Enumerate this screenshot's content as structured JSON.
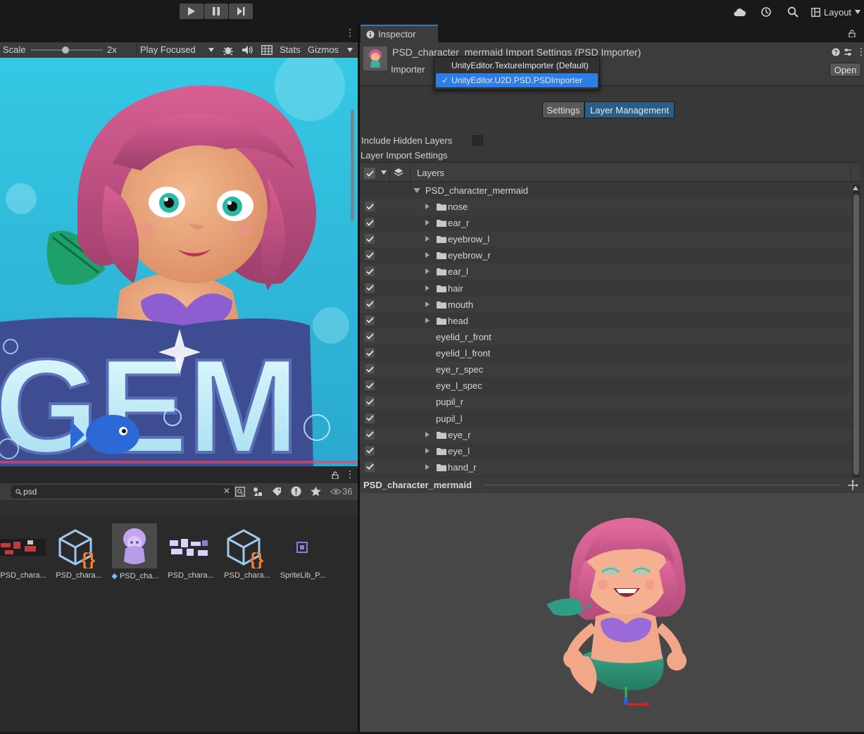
{
  "toolbar": {
    "play_icon": "play-icon",
    "pause_icon": "pause-icon",
    "step_icon": "step-icon",
    "layout_label": "Layout"
  },
  "game": {
    "scale_label": "Scale",
    "scale_value": "2x",
    "play_mode": "Play Focused",
    "stats_label": "Stats",
    "gizmos_label": "Gizmos",
    "title_text": "GEM"
  },
  "project": {
    "search_value": "psd",
    "count": "36",
    "assets": [
      {
        "label": "PSD_chara...",
        "icon": "layer-sprite-sheet-icon"
      },
      {
        "label": "PSD_chara...",
        "icon": "cube-script-icon"
      },
      {
        "label": "PSD_cha...",
        "icon": "mermaid-prefab-icon"
      },
      {
        "label": "PSD_chara...",
        "icon": "layer-sprite-sheet-icon"
      },
      {
        "label": "PSD_chara...",
        "icon": "cube-script-icon"
      },
      {
        "label": "SpriteLib_P...",
        "icon": "sprite-library-icon"
      }
    ]
  },
  "inspector": {
    "tab_label": "Inspector",
    "title": "PSD_character_mermaid Import Settings (PSD Importer)",
    "importer_label": "Importer",
    "open_label": "Open",
    "dropdown_options": [
      {
        "label": "UnityEditor.TextureImporter (Default)",
        "selected": false
      },
      {
        "label": "UnityEditor.U2D.PSD.PSDImporter",
        "selected": true
      }
    ],
    "tabs": [
      "Settings",
      "Layer Management"
    ],
    "active_tab": "Layer Management",
    "include_hidden_label": "Include Hidden Layers",
    "layer_import_label": "Layer Import Settings",
    "layers_header": "Layers",
    "root_layer": "PSD_character_mermaid",
    "layers": [
      {
        "name": "nose",
        "group": true
      },
      {
        "name": "ear_r",
        "group": true
      },
      {
        "name": "eyebrow_l",
        "group": true
      },
      {
        "name": "eyebrow_r",
        "group": true
      },
      {
        "name": "ear_l",
        "group": true
      },
      {
        "name": "hair",
        "group": true
      },
      {
        "name": "mouth",
        "group": true
      },
      {
        "name": "head",
        "group": true
      },
      {
        "name": "eyelid_r_front",
        "group": false
      },
      {
        "name": "eyelid_l_front",
        "group": false
      },
      {
        "name": "eye_r_spec",
        "group": false
      },
      {
        "name": "eye_l_spec",
        "group": false
      },
      {
        "name": "pupil_r",
        "group": false
      },
      {
        "name": "pupil_l",
        "group": false
      },
      {
        "name": "eye_r",
        "group": true
      },
      {
        "name": "eye_l",
        "group": true
      },
      {
        "name": "hand_r",
        "group": true
      }
    ],
    "preview_title": "PSD_character_mermaid"
  },
  "colors": {
    "accent": "#2c5d87",
    "selection": "#2c7ee6",
    "panel": "#383838",
    "header": "#3c3c3c"
  }
}
